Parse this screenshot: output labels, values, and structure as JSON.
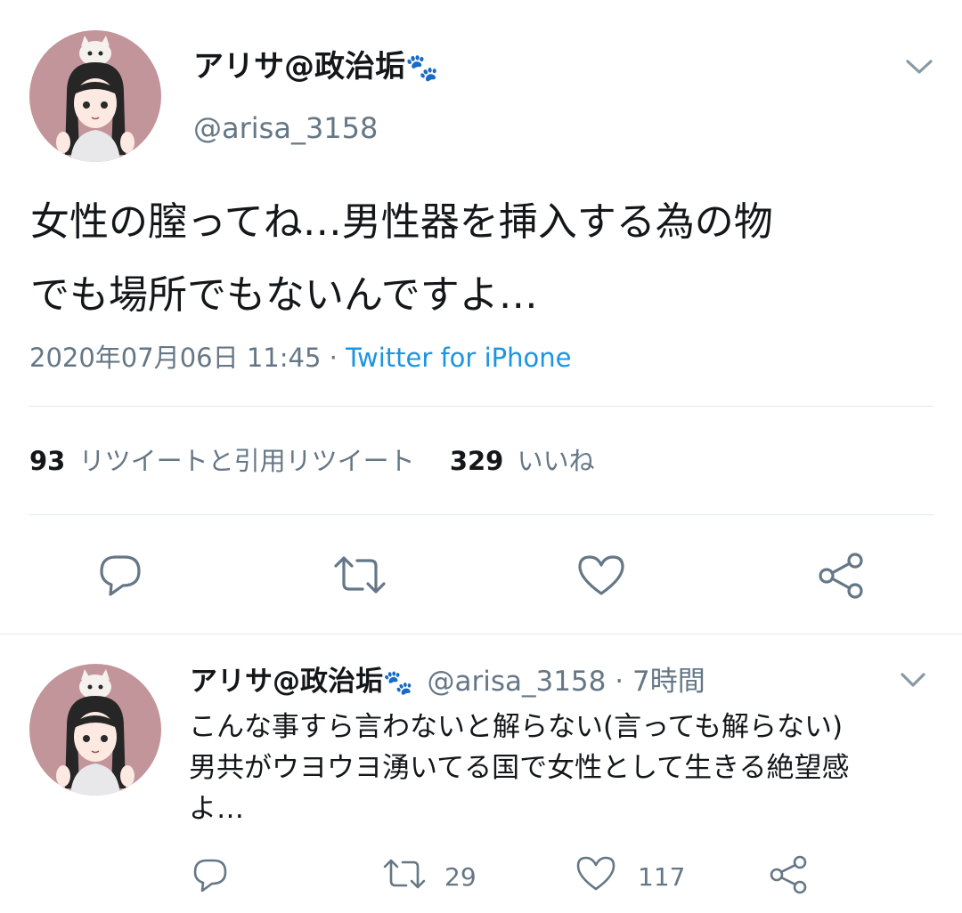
{
  "main_tweet": {
    "display_name": "アリサ@政治垢",
    "handle": "@arisa_3158",
    "text_line1": "女性の膣ってね…男性器を挿入する為の物",
    "text_line2": "でも場所でもないんですよ…",
    "timestamp": "2020年07月06日 11:45",
    "separator": "·",
    "source": "Twitter for iPhone",
    "retweet_count": "93",
    "retweet_label": "リツイートと引用リツイート",
    "like_count": "329",
    "like_label": "いいね",
    "paw_emoji": "🐾"
  },
  "reply_tweet": {
    "display_name": "アリサ@政治垢",
    "handle": "@arisa_3158",
    "separator": "·",
    "time_ago": "7時間",
    "text_line1": "こんな事すら言わないと解らない(言っても解らない)",
    "text_line2": "男共がウヨウヨ湧いてる国で女性として生きる絶望感",
    "text_line3": "よ…",
    "retweet_count": "29",
    "like_count": "117"
  },
  "colors": {
    "link": "#1b95e0",
    "muted": "#657786",
    "divider": "#e1e8ed",
    "avatar_bg": "#c2959a"
  },
  "icons": [
    "chevron-down-icon",
    "reply-icon",
    "retweet-icon",
    "like-icon",
    "share-icon",
    "paw-icon"
  ]
}
